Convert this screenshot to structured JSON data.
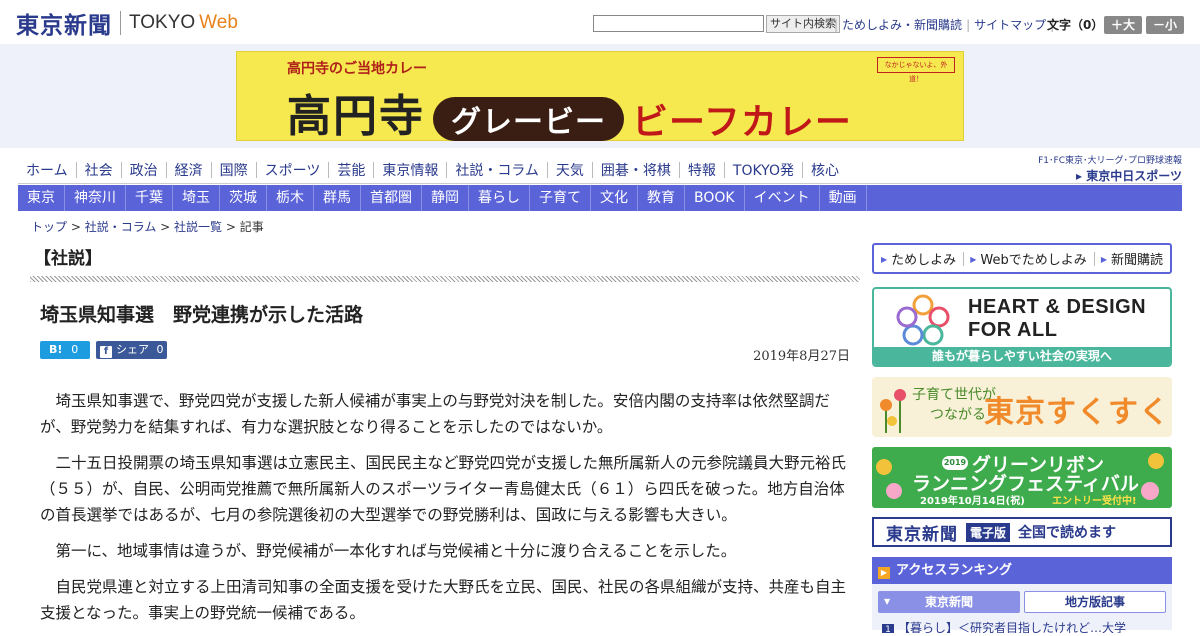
{
  "header": {
    "logo_jp": "東京新聞",
    "logo_en": "TOKYO",
    "logo_web": "Web",
    "search_button": "サイト内検索",
    "links": [
      "ためしよみ・新聞購読",
      "サイトマップ"
    ],
    "font_size_label": "文字（0）",
    "font_larger": "＋大",
    "font_smaller": "－小"
  },
  "banner": {
    "subtitle": "高円寺のご当地カレー",
    "main": "高円寺",
    "pill": "グレービー",
    "right": "ビーフカレー",
    "badge": "なかじゃないよ、外道！",
    "colors": {
      "bg": "#f6e84f",
      "accent": "#c01818",
      "pill": "#3a1e14"
    }
  },
  "nav_primary": [
    "ホーム",
    "社会",
    "政治",
    "経済",
    "国際",
    "スポーツ",
    "芸能",
    "東京情報",
    "社説・コラム",
    "天気",
    "囲碁・将棋",
    "特報",
    "TOKYO発",
    "核心"
  ],
  "chunichi": {
    "top": "F1･FC東京･大リーグ･プロ野球速報",
    "bottom": "▸ 東京中日スポーツ"
  },
  "nav_regional": [
    "東京",
    "神奈川",
    "千葉",
    "埼玉",
    "茨城",
    "栃木",
    "群馬",
    "首都圏",
    "静岡",
    "暮らし",
    "子育て",
    "文化",
    "教育",
    "BOOK",
    "イベント",
    "動画"
  ],
  "breadcrumb": {
    "items": [
      "トップ",
      "社説・コラム",
      "社説一覧"
    ],
    "current": "記事",
    "separator": " > "
  },
  "article": {
    "section": "【社説】",
    "title": "埼玉県知事選　野党連携が示した活路",
    "hatena_label": "B!",
    "hatena_count": "0",
    "fb_icon": "f",
    "fb_label": "シェア",
    "fb_count": "0",
    "date": "2019年8月27日",
    "paragraphs": [
      "埼玉県知事選で、野党四党が支援した新人候補が事実上の与野党対決を制した。安倍内閣の支持率は依然堅調だが、野党勢力を結集すれば、有力な選択肢となり得ることを示したのではないか。",
      "二十五日投開票の埼玉県知事選は立憲民主、国民民主など野党四党が支援した無所属新人の元参院議員大野元裕氏（５５）が、自民、公明両党推薦で無所属新人のスポーツライター青島健太氏（６１）ら四氏を破った。地方自治体の首長選挙ではあるが、七月の参院選後初の大型選挙での野党勝利は、国政に与える影響も大きい。",
      "第一に、地域事情は違うが、野党候補が一本化すれば与党候補と十分に渡り合えることを示した。",
      "自民党県連と対立する上田清司知事の全面支援を受けた大野氏を立民、国民、社民の各県組織が支持、共産も自主支援となった。事実上の野党統一候補である。"
    ]
  },
  "sidebar": {
    "tame_links": [
      "ためしよみ",
      "Webでためしよみ",
      "新聞購読"
    ],
    "heart": {
      "title_line1": "HEART & DESIGN",
      "title_line2": "FOR ALL",
      "footer": "誰もが暮らしやすい社会の実現へ"
    },
    "sukusuku": {
      "small_line1": "子育て世代が",
      "small_line2": "つながる",
      "big": "東京すくすく"
    },
    "green": {
      "year": "2019",
      "line1": "グリーンリボン",
      "line2": "ランニングフェスティバル",
      "date": "2019年10月14日(祝)",
      "entry": "エントリー受付中!"
    },
    "edition": {
      "logo": "東京新聞",
      "badge": "電子版",
      "text": "全国で読めます"
    },
    "ranking": {
      "title": "アクセスランキング",
      "tabs": [
        "東京新聞",
        "地方版記事"
      ],
      "first_num": "1",
      "first_item": "【暮らし】＜研究者目指したけれど…大学"
    }
  },
  "colors": {
    "brand_navy": "#2a3a8c",
    "nav_purple": "#5b63d8",
    "web_orange": "#e8821a"
  }
}
